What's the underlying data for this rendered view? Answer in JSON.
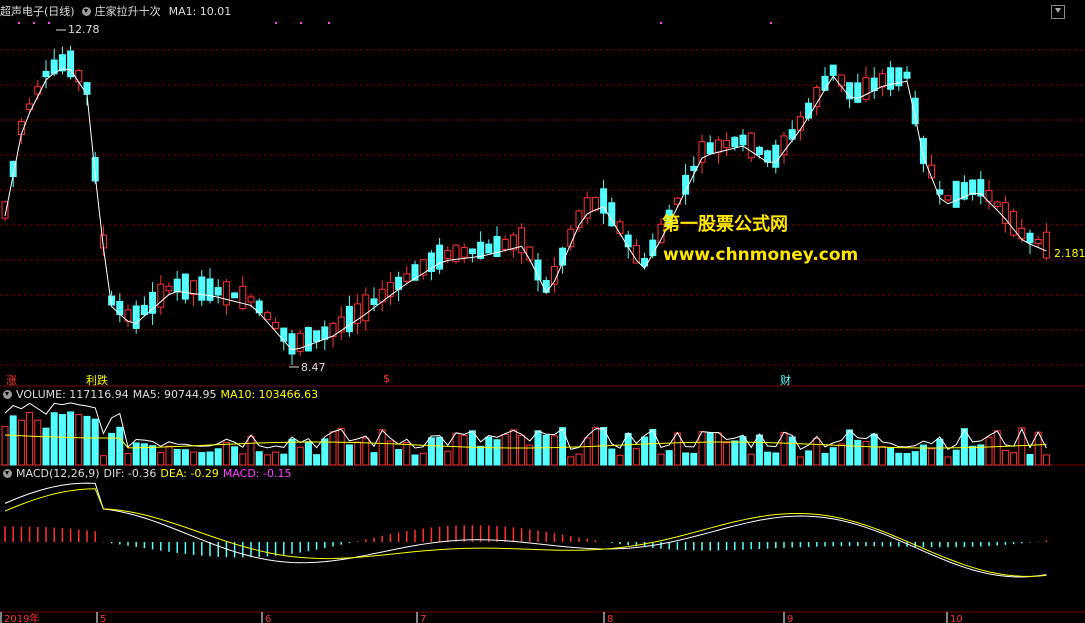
{
  "header": {
    "stock": "超声电子(日线)",
    "indicator": "庄家拉升十次",
    "ma1": "MA1: 10.01"
  },
  "price": {
    "high_label": "12.78",
    "low_label": "8.47",
    "last_label": "2.181"
  },
  "watermark": {
    "line1": "第一股票公式网",
    "line2": "www.chnmoney.com"
  },
  "events": [
    "涨",
    "利跌",
    "$",
    "财"
  ],
  "volume_header": {
    "label": "VOLUME: 117116.94",
    "ma5": "MA5: 90744.95",
    "ma10": "MA10: 103466.63"
  },
  "macd_header": {
    "label": "MACD(12,26,9)",
    "dif": "DIF: -0.36",
    "dea": "DEA: -0.29",
    "macd": "MACD: -0.15"
  },
  "xaxis": [
    "2019年",
    "5",
    "6",
    "7",
    "8",
    "9",
    "10"
  ],
  "colors": {
    "up": "#ff3232",
    "down": "#54ffff",
    "grid": "#7a0000",
    "yellow": "#ffff00",
    "magenta": "#ff40ff"
  }
}
